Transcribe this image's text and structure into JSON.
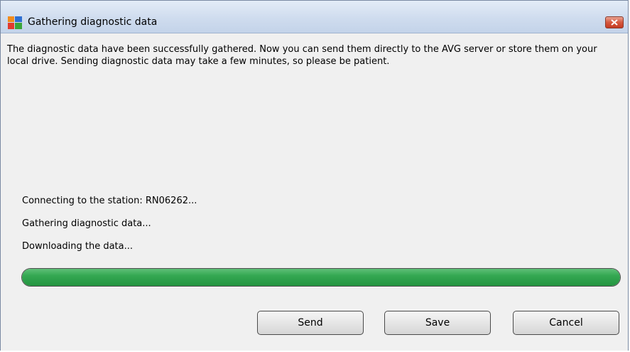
{
  "window": {
    "title": "Gathering diagnostic data",
    "accent_color": "#cfdcee",
    "close_icon": "close-icon",
    "app_icon": "avg-logo-icon"
  },
  "message": {
    "intro": "The diagnostic data have been successfully gathered. Now you can send them directly to the AVG server or store them on your local drive. Sending diagnostic data may take a few minutes, so please be patient."
  },
  "status": {
    "lines": [
      "Connecting to the station: RN06262...",
      "Gathering diagnostic data...",
      "Downloading the data..."
    ]
  },
  "progress": {
    "percent": 100,
    "color": "#2e9f4a"
  },
  "buttons": {
    "send": "Send",
    "save": "Save",
    "cancel": "Cancel"
  }
}
